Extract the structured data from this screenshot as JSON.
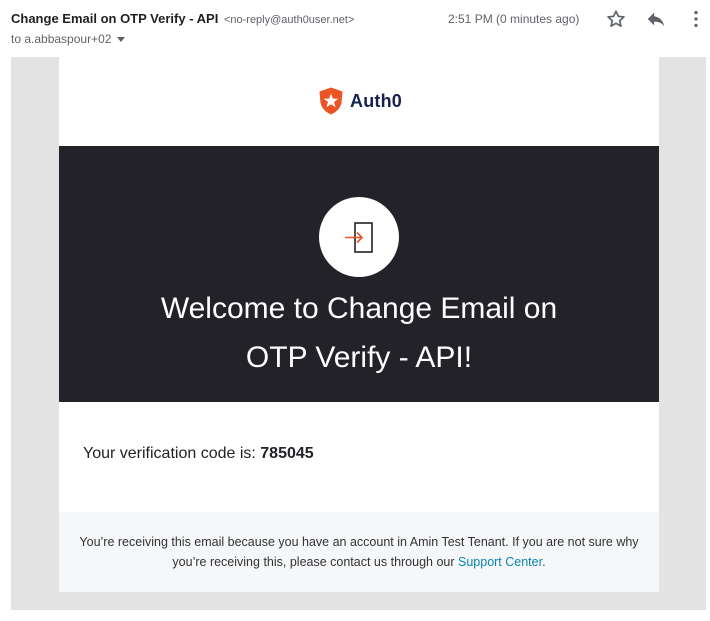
{
  "header": {
    "subject": "Change Email on OTP Verify - API",
    "sender": "<no-reply@auth0user.net>",
    "recipient": "to a.abbaspour+02",
    "timestamp": "2:51 PM (0 minutes ago)",
    "icons": [
      "star-icon",
      "reply-icon",
      "more-vert-icon"
    ]
  },
  "email": {
    "brand": "Auth0",
    "brand_color": "#eb5424",
    "hero_bg": "#222228",
    "welcome_line1": "Welcome to Change Email on",
    "welcome_line2": "OTP Verify - API!",
    "code_prefix": "Your verification code is: ",
    "code": "785045",
    "footer_part1": "You’re receiving this email because you have an account in Amin Test Tenant. If you are not sure why you’re receiving this, please contact us through our ",
    "footer_link": "Support Center",
    "footer_part2": ".",
    "link_color": "#0a84ae"
  }
}
